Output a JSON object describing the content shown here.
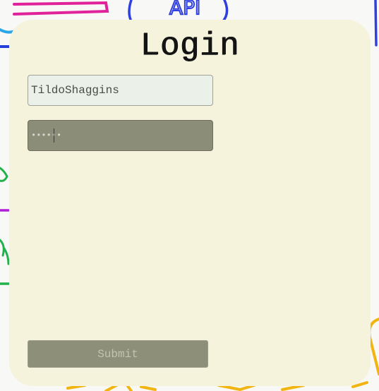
{
  "login": {
    "title": "Login",
    "username_value": "TildoShaggins",
    "password_value": "••••••",
    "submit_label": "Submit"
  },
  "colors": {
    "card_background": "#f5f3dc",
    "username_field": "#ebf0e8",
    "password_field": "#8c8d79",
    "submit_button": "#8e8f79",
    "title_text": "#141414"
  },
  "background": {
    "visible_text": "API"
  }
}
